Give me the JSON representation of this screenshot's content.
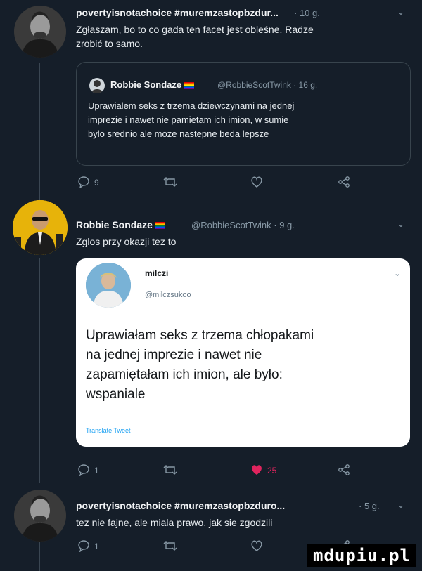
{
  "tweet1": {
    "author": "povertyisnotachoice #muremzastopbzdur...",
    "time": "· 10 g.",
    "text_line1": "Zgłaszam, bo to co gada ten facet jest obleśne. Radze",
    "text_line2": "zrobić to samo.",
    "quote": {
      "name": "Robbie Sondaze",
      "handle": "@RobbieScotTwink · 16 g.",
      "line1": "Uprawialem seks z trzema dziewczynami na jednej",
      "line2": "imprezie i nawet nie pamietam ich imion, w sumie",
      "line3": "bylo srednio ale moze nastepne beda lepsze"
    },
    "reply_count": "9",
    "retweet_count": "",
    "like_count": ""
  },
  "tweet2": {
    "name": "Robbie Sondaze",
    "handle": "@RobbieScotTwink · 9 g.",
    "text": "Zglos przy okazji tez to",
    "quote": {
      "name": "milczi",
      "handle": "@milczsukoo",
      "line1": "Uprawiałam seks z trzema chłopakami",
      "line2": "na jednej imprezie i nawet nie",
      "line3": "zapamiętałam ich imion, ale było:",
      "line4": "wspaniale",
      "translate": "Translate Tweet"
    },
    "reply_count": "1",
    "like_count": "25"
  },
  "tweet3": {
    "author": "povertyisnotachoice #muremzastopbzduro...",
    "time": "· 5 g.",
    "text": "tez nie fajne, ale miala prawo, jak sie zgodzili",
    "reply_count": "1"
  },
  "watermark": "mdupiu.pl",
  "colors": {
    "like_active": "#e0245e",
    "muted": "#8899a6",
    "background": "#151e29"
  }
}
